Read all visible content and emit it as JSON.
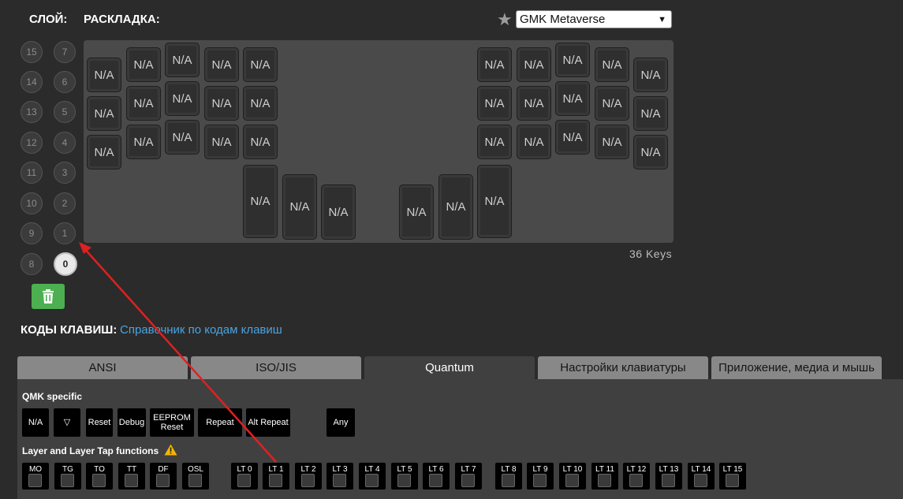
{
  "header": {
    "layer_label": "СЛОЙ:",
    "layout_label": "РАСКЛАДКА:"
  },
  "preset": {
    "selected": "GMK Metaverse",
    "star_icon": "star-icon"
  },
  "layers": {
    "left": [
      "15",
      "14",
      "13",
      "12",
      "11",
      "10",
      "9",
      "8"
    ],
    "right": [
      "7",
      "6",
      "5",
      "4",
      "3",
      "2",
      "1",
      "0"
    ],
    "active": "0"
  },
  "keyboard": {
    "key_label": "N/A",
    "count_text": "36 Keys"
  },
  "codes": {
    "label": "КОДЫ КЛАВИШ:",
    "link": "Справочник по кодам клавиш"
  },
  "tabs": [
    {
      "label": "ANSI"
    },
    {
      "label": "ISO/JIS"
    },
    {
      "label": "Quantum"
    },
    {
      "label": "Настройки клавиатуры"
    },
    {
      "label": "Приложение, медиа и мышь"
    }
  ],
  "qmk": {
    "title": "QMK specific",
    "buttons": [
      "N/A",
      "▽",
      "Reset",
      "Debug",
      "EEPROM Reset",
      "Repeat",
      "Alt Repeat",
      "Any"
    ]
  },
  "layer_tap": {
    "title": "Layer and Layer Tap functions",
    "group1": [
      "MO",
      "TG",
      "TO",
      "TT",
      "DF",
      "OSL"
    ],
    "group2": [
      "LT 0",
      "LT 1",
      "LT 2",
      "LT 3",
      "LT 4",
      "LT 5",
      "LT 6",
      "LT 7"
    ],
    "group3": [
      "LT 8",
      "LT 9",
      "LT 10",
      "LT 11",
      "LT 12",
      "LT 13",
      "LT 14",
      "LT 15"
    ]
  },
  "colors": {
    "accent_link": "#4aa3e0",
    "trash_green": "#4caf50",
    "annotation_arrow": "#e02020",
    "warning": "#f5b400"
  }
}
